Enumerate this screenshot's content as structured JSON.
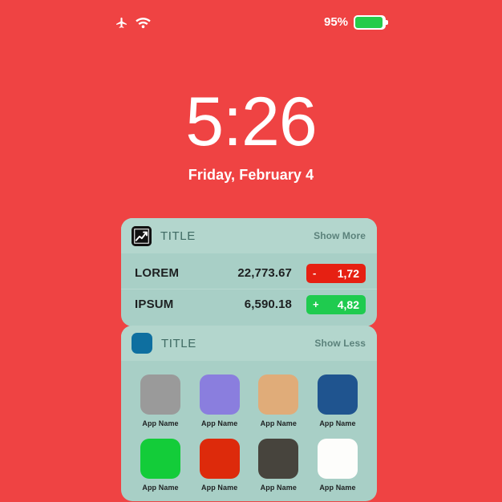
{
  "wallpaper": {
    "background_color": "#ef4343"
  },
  "status_bar": {
    "icons": [
      "airplane-mode-icon",
      "wifi-icon"
    ],
    "battery_percent_label": "95%",
    "battery_level": 95,
    "battery_color": "#25cc4a"
  },
  "lock_screen": {
    "time": "5:26",
    "date": "Friday, February 4"
  },
  "widgets": [
    {
      "id": "stocks",
      "icon": "stocks-chart-icon",
      "title": "TITLE",
      "action_label": "Show More",
      "rows": [
        {
          "symbol": "LOREM",
          "price": "22,773.67",
          "change_sign": "-",
          "change_value": "1,72",
          "direction": "down",
          "badge_color": "#e62012"
        },
        {
          "symbol": "IPSUM",
          "price": "6,590.18",
          "change_sign": "+",
          "change_value": "4,82",
          "direction": "up",
          "badge_color": "#1fcb4f"
        }
      ]
    },
    {
      "id": "apps",
      "icon": "app-square-icon",
      "title": "TITLE",
      "action_label": "Show Less",
      "apps": [
        {
          "label": "App Name",
          "color": "#9a9a9a"
        },
        {
          "label": "App Name",
          "color": "#8a7ede"
        },
        {
          "label": "App Name",
          "color": "#e0ac79"
        },
        {
          "label": "App Name",
          "color": "#1f548f"
        },
        {
          "label": "App Name",
          "color": "#13cc39"
        },
        {
          "label": "App Name",
          "color": "#dd2a0b"
        },
        {
          "label": "App Name",
          "color": "#47443d"
        },
        {
          "label": "App Name",
          "color": "#fdfdfb"
        }
      ]
    }
  ]
}
